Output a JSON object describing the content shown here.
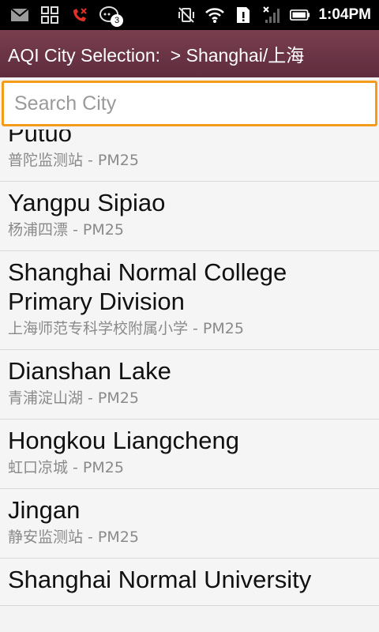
{
  "status_bar": {
    "time": "1:04PM",
    "notification_count": "3",
    "left_icons": [
      "gmail-icon",
      "apps-grid-icon",
      "missed-call-icon",
      "chat-bubble-icon"
    ],
    "right_icons": [
      "vibrate-off-icon",
      "wifi-icon",
      "sim-alert-icon",
      "no-signal-icon",
      "battery-icon"
    ]
  },
  "title_bar": {
    "title": "AQI City Selection:  > Shanghai/上海"
  },
  "search": {
    "placeholder": "Search City",
    "value": ""
  },
  "list": {
    "items": [
      {
        "name": "Putuo",
        "subtitle": "普陀监测站 - PM25"
      },
      {
        "name": "Yangpu Sipiao",
        "subtitle": "杨浦四漂 - PM25"
      },
      {
        "name": "Shanghai Normal College Primary Division",
        "subtitle": "上海师范专科学校附属小学 - PM25"
      },
      {
        "name": "Dianshan Lake",
        "subtitle": "青浦淀山湖 - PM25"
      },
      {
        "name": "Hongkou Liangcheng",
        "subtitle": "虹口凉城 - PM25"
      },
      {
        "name": "Jingan",
        "subtitle": "静安监测站 - PM25"
      },
      {
        "name": "Shanghai Normal University",
        "subtitle": ""
      }
    ]
  },
  "colors": {
    "accent": "#f59b1a",
    "title_bar": "#6a3445",
    "status_bar": "#000000"
  }
}
